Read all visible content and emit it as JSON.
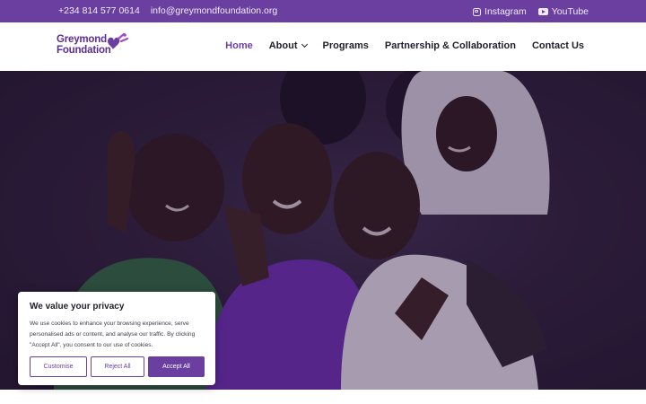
{
  "topbar": {
    "phone": "+234 814 577 0614",
    "email": "info@greymondfoundation.org",
    "social": [
      {
        "label": "Instagram",
        "icon": "instagram-icon"
      },
      {
        "label": "YouTube",
        "icon": "youtube-icon"
      }
    ]
  },
  "logo": {
    "line1": "Greymond",
    "line2": "Foundation"
  },
  "nav": {
    "items": [
      {
        "label": "Home",
        "active": true
      },
      {
        "label": "About",
        "has_dropdown": true
      },
      {
        "label": "Programs"
      },
      {
        "label": "Partnership & Collaboration"
      },
      {
        "label": "Contact Us"
      }
    ]
  },
  "cookie": {
    "title": "We value your privacy",
    "body": "We use cookies to enhance your browsing experience, serve personalised ads or content, and analyse our traffic. By clicking \"Accept All\", you consent to our use of cookies.",
    "customise_label": "Customise",
    "reject_label": "Reject All",
    "accept_label": "Accept All"
  },
  "colors": {
    "brand_purple": "#6b3fa0",
    "text_dark": "#1f1f2b",
    "accent_magenta": "#a24bc4"
  }
}
